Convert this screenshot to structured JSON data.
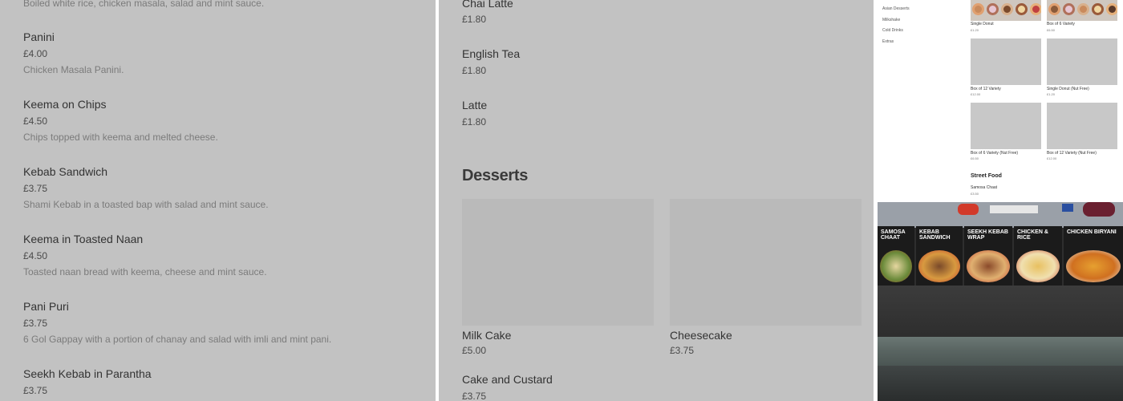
{
  "left_menu": {
    "cut_desc": "Boiled white rice, chicken masala, salad and mint sauce.",
    "items": [
      {
        "name": "Panini",
        "price": "£4.00",
        "desc": "Chicken Masala Panini."
      },
      {
        "name": "Keema on Chips",
        "price": "£4.50",
        "desc": "Chips topped with keema and melted cheese."
      },
      {
        "name": "Kebab Sandwich",
        "price": "£3.75",
        "desc": "Shami Kebab in a toasted bap with salad and mint sauce."
      },
      {
        "name": "Keema in Toasted Naan",
        "price": "£4.50",
        "desc": "Toasted naan bread with keema, cheese and mint sauce."
      },
      {
        "name": "Pani Puri",
        "price": "£3.75",
        "desc": "6 Gol Gappay with a portion of chanay and salad with imli and mint pani."
      },
      {
        "name": "Seekh Kebab in Parantha",
        "price": "£3.75",
        "desc": ""
      }
    ]
  },
  "middle_menu": {
    "drinks": [
      {
        "name": "Chai Latte",
        "price": "£1.80"
      },
      {
        "name": "English Tea",
        "price": "£1.80"
      },
      {
        "name": "Latte",
        "price": "£1.80"
      }
    ],
    "section_title": "Desserts",
    "cards": [
      {
        "name": "Milk Cake",
        "price": "£5.00"
      },
      {
        "name": "Cheesecake",
        "price": "£3.75"
      }
    ],
    "bottom_item": {
      "name": "Cake and Custard",
      "price": "£3.75"
    }
  },
  "mini_screenshot": {
    "categories": [
      "Asian Desserts",
      "Milkshake",
      "Cold Drinks",
      "Extras"
    ],
    "products": [
      {
        "name": "Single Donut",
        "price": "£1.20"
      },
      {
        "name": "Box of 6 Variety",
        "price": "£6.50"
      },
      {
        "name": "Box of 12 Variety",
        "price": "£12.00"
      },
      {
        "name": "Single Donut (Nut Free)",
        "price": "£1.20"
      },
      {
        "name": "Box of 6 Variety (Nut Free)",
        "price": "£6.50"
      },
      {
        "name": "Box of 12 Variety (Nut Free)",
        "price": "£12.00"
      }
    ],
    "section": "Street Food",
    "section_item": {
      "name": "Samosa Chaat",
      "price": "£3.50"
    }
  },
  "photo": {
    "boards": [
      "SAMOSA CHAAT",
      "KEBAB SANDWICH",
      "SEEKH KEBAB WRAP",
      "CHICKEN & RICE",
      "CHICKEN BIRYANI"
    ]
  }
}
